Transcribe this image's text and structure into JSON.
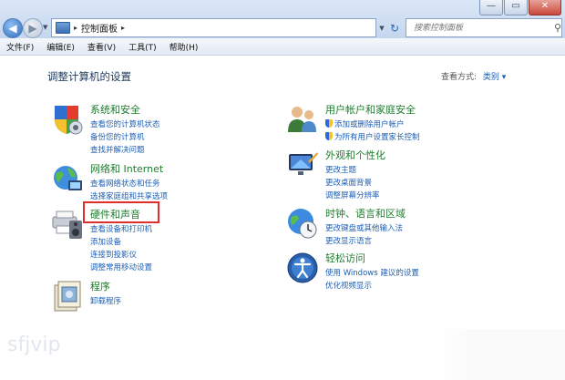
{
  "titlebar": {
    "minimize_icon": "minimize-icon",
    "maximize_icon": "maximize-icon",
    "close_icon": "close-icon"
  },
  "address": {
    "separator": "▸",
    "path": "控制面板",
    "trail": "▸"
  },
  "search": {
    "placeholder": "搜索控制面板"
  },
  "menu": [
    "文件(F)",
    "编辑(E)",
    "查看(V)",
    "工具(T)",
    "帮助(H)"
  ],
  "page": {
    "title": "调整计算机的设置",
    "view_by_label": "查看方式:",
    "view_by_value": "类别 ▾"
  },
  "categories": {
    "system": {
      "title": "系统和安全",
      "links": [
        "查看您的计算机状态",
        "备份您的计算机",
        "查找并解决问题"
      ]
    },
    "network": {
      "title": "网络和 Internet",
      "links": [
        "查看网络状态和任务",
        "选择家庭组和共享选项"
      ]
    },
    "hardware": {
      "title": "硬件和声音",
      "links": [
        "查看设备和打印机",
        "添加设备",
        "连接到投影仪",
        "调整常用移动设置"
      ]
    },
    "programs": {
      "title": "程序",
      "links": [
        "卸载程序"
      ]
    },
    "users": {
      "title": "用户帐户和家庭安全",
      "links": [
        "添加或删除用户帐户",
        "为所有用户设置家长控制"
      ]
    },
    "appearance": {
      "title": "外观和个性化",
      "links": [
        "更改主题",
        "更改桌面背景",
        "调整屏幕分辨率"
      ]
    },
    "clock": {
      "title": "时钟、语言和区域",
      "links": [
        "更改键盘或其他输入法",
        "更改显示语言"
      ]
    },
    "ease": {
      "title": "轻松访问",
      "links": [
        "使用 Windows 建议的设置",
        "优化视频显示"
      ]
    }
  },
  "watermark": "sfjvip",
  "colors": {
    "accent_link": "#1c5eb5",
    "category_title": "#1e7c2d",
    "highlight": "#e02d2d"
  }
}
